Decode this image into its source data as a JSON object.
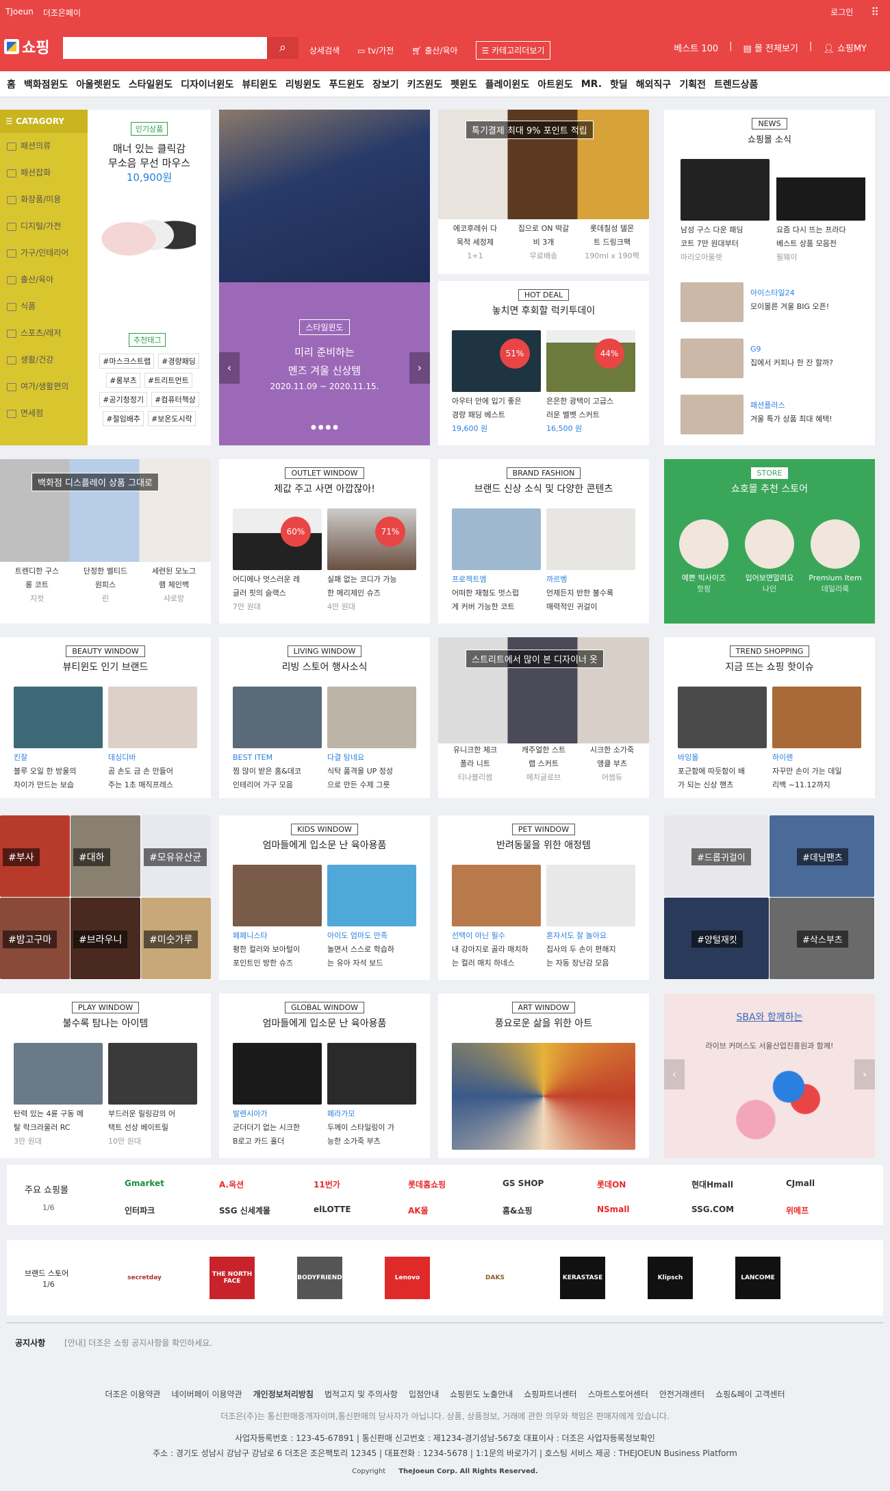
{
  "topbar": {
    "brand": "TJoeun",
    "pay": "더조은페이",
    "login": "로그인"
  },
  "header": {
    "logo": "쇼핑",
    "search_placeholder": "",
    "detail": "상세검색",
    "tv": "tv/가전",
    "baby": "출산/육아",
    "catall": "카테고리더보기",
    "best": "베스트 100",
    "seeall": "몰 전체보기",
    "my": "쇼핑MY"
  },
  "cats": [
    "홈",
    "백화점윈도",
    "아울렛윈도",
    "스타일윈도",
    "디자이너윈도",
    "뷰티윈도",
    "리빙윈도",
    "푸드윈도",
    "장보기",
    "키즈윈도",
    "펫윈도",
    "플레이윈도",
    "아트윈도",
    "MR.",
    "핫딜",
    "해외직구",
    "기획전",
    "트렌드상품"
  ],
  "sidebar": {
    "title": "CATAGORY",
    "items": [
      "패션의류",
      "패션잡화",
      "화장품/미용",
      "디지털/가전",
      "가구/인테리어",
      "출산/육아",
      "식품",
      "스포츠/레저",
      "생활/건강",
      "여가/생활편의",
      "면세점"
    ]
  },
  "popular": {
    "tag": "인기상품",
    "title1": "매너 있는 클릭감",
    "title2": "무소음 무선 마우스",
    "price": "10,900원",
    "rectag": "추천태그",
    "tags": [
      "#마스크스트랩",
      "#경량패딩",
      "#롱부츠",
      "#트리트먼트",
      "#공기청정기",
      "#컴퓨터책상",
      "#절임배추",
      "#보온도시락"
    ]
  },
  "hero": {
    "tag": "스타일윈도",
    "l1": "미리 준비하는",
    "l2": "멘즈 겨울 신상템",
    "date": "2020.11.09 ~ 2020.11.15."
  },
  "promo": {
    "banner": "톡기결제 최대 9% 포인트 적립",
    "items": [
      {
        "n1": "에코후레쉬 다",
        "n2": "목적 세정제",
        "s": "1+1"
      },
      {
        "n1": "집으로 ON 떡갈",
        "n2": "비 3개",
        "s": "무료배송"
      },
      {
        "n1": "롯데칠성 델몬",
        "n2": "트 드링크팩",
        "s": "190ml x 190팩"
      }
    ]
  },
  "news": {
    "tag": "NEWS",
    "title": "쇼핑몰 소식",
    "items": [
      {
        "n1": "남성 구스 다운 패딩",
        "n2": "코트 7만 원대부터",
        "s": "마리오아울렛"
      },
      {
        "n1": "요즘 다시 뜨는 프라다",
        "n2": "베스트 상품 모음전",
        "s": "필웨이"
      }
    ],
    "list": [
      {
        "b": "아이스타일24",
        "t": "모이몰른 겨울 BIG 오픈!"
      },
      {
        "b": "G9",
        "t": "집에서 커피나 한 잔 할까?"
      },
      {
        "b": "패션플러스",
        "t": "겨울 특가 상품 최대 혜택!"
      }
    ]
  },
  "hotdeal": {
    "tag": "HOT DEAL",
    "title": "놓치면 후회할 럭키투데이",
    "items": [
      {
        "pct": "51%",
        "n1": "아우터 안에 입기 좋은",
        "n2": "경량 패딩 베스트",
        "p": "19,600 원"
      },
      {
        "pct": "44%",
        "n1": "은은한 광택이 고급스",
        "n2": "러운 벨벳 스커트",
        "p": "16,500 원"
      }
    ]
  },
  "row2": {
    "dept": {
      "banner": "백화점 디스플레이 상품 그대로",
      "items": [
        {
          "n1": "트렌디한 구스",
          "n2": "롱 코트",
          "s": "지컷"
        },
        {
          "n1": "단정한 벨티드",
          "n2": "원피스",
          "s": "린"
        },
        {
          "n1": "세련된 모노그",
          "n2": "램 체인백",
          "s": "샤로랑"
        }
      ]
    },
    "outlet": {
      "tag": "OUTLET WINDOW",
      "title": "제값 주고 사면 아깝잖아!",
      "items": [
        {
          "pct": "60%",
          "n1": "어디에나 멋스러운 레",
          "n2": "글러 핏의 슬랙스",
          "s": "7만 원대"
        },
        {
          "pct": "71%",
          "n1": "실패 없는 코디가 가능",
          "n2": "한 메리제인 슈즈",
          "s": "4만 원대"
        }
      ]
    },
    "brand": {
      "tag": "BRAND FASHION",
      "title": "브랜드 신상 소식 및 다양한 콘텐츠",
      "items": [
        {
          "b": "프로젝트엠",
          "n1": "어떠한 재형도 멋스럽",
          "n2": "게 커버 가능한 코트"
        },
        {
          "b": "까르벵",
          "n1": "언제든지 반한 불수록",
          "n2": "매력적인 귀걸이"
        }
      ]
    },
    "store": {
      "tag": "STORE",
      "title": "쇼호몰 추천 스토어",
      "items": [
        {
          "n": "예쁜 빅사이즈",
          "s": "핫핑"
        },
        {
          "n": "입어보면알려요",
          "s": "나인"
        },
        {
          "n": "Premium Item",
          "s": "데일리룩"
        }
      ]
    }
  },
  "row3": {
    "beauty": {
      "tag": "BEAUTY WINDOW",
      "title": "뷰티윈도 인기 브랜드",
      "items": [
        {
          "b": "킨잘",
          "n1": "블루 오일 한 방울의",
          "n2": "차이가 만드는 보습"
        },
        {
          "b": "데싱디바",
          "n1": "곰 손도 금 손 만들어",
          "n2": "주는 1초 매직프레스"
        }
      ]
    },
    "living": {
      "tag": "LIVING WINDOW",
      "title": "리빙 스토어 행사소식",
      "items": [
        {
          "b": "BEST ITEM",
          "n1": "찜 많이 받은 홈&데코",
          "n2": "인테리어 가구 모음"
        },
        {
          "b": "다결 탕네요",
          "n1": "식탁 품격을 UP 정성",
          "n2": "으로 만든 수제 그릇"
        }
      ]
    },
    "street": {
      "banner": "스트리트에서 많이 본 디자이너 옷",
      "items": [
        {
          "n1": "유니크한 체크",
          "n2": "폴라 니트",
          "s": "티나블리썸"
        },
        {
          "n1": "캐주얼한 스트",
          "n2": "랩 스커트",
          "s": "메치글로브"
        },
        {
          "n1": "시크한 소가죽",
          "n2": "앵클 부츠",
          "s": "어썸듀"
        }
      ]
    },
    "trend": {
      "tag": "TREND SHOPPING",
      "title": "지금 뜨는 쇼핑 핫이슈",
      "items": [
        {
          "b": "바잉몰",
          "n1": "포근함에 따듯함이 배",
          "n2": "가 되는 신상 핸츠"
        },
        {
          "b": "하이렌",
          "n1": "자꾸만 손이 가는 데일",
          "n2": "리백 ~11.12까지"
        }
      ]
    }
  },
  "row4": {
    "food": {
      "labels": [
        "#부사",
        "#대하",
        "#모유유산균",
        "#밤고구마",
        "#브라우니",
        "#미숫가루"
      ]
    },
    "kids": {
      "tag": "KIDS WINDOW",
      "title": "엄마들에게 입소문 난 육아용품",
      "items": [
        {
          "b": "페페니스타",
          "n1": "평한 컬러와 보아털이",
          "n2": "포인트인 방한 슈즈"
        },
        {
          "b": "아이도 엄마도 만족",
          "n1": "놀면서 스스로 학습하",
          "n2": "는 유아 자석 보드"
        }
      ]
    },
    "pet": {
      "tag": "PET WINDOW",
      "title": "반려동물을 위한 애정템",
      "items": [
        {
          "b": "선택이 아닌 필수",
          "n1": "내 강아지로 골라 매치하",
          "n2": "는 컬러 매치 하네스"
        },
        {
          "b": "혼자서도 잘 놀아요",
          "n1": "집사의 두 손이 편해지",
          "n2": "는 자동 장난감 모음"
        }
      ]
    },
    "fashion": {
      "labels": [
        "#드롭귀걸이",
        "#데님팬츠",
        "#양털재킷",
        "#삭스부츠"
      ]
    }
  },
  "row5": {
    "play": {
      "tag": "PLAY WINDOW",
      "title": "불수록 탐나는 아이템",
      "items": [
        {
          "n1": "탄력 있는 4륜 구동 메",
          "n2": "탈 락크라울러 RC",
          "s": "3만 원대"
        },
        {
          "n1": "부드러운 릴링감의 어",
          "n2": "택트 선상 베이트릴",
          "s": "10만 원대"
        }
      ]
    },
    "global": {
      "tag": "GLOBAL WINDOW",
      "title": "엄마들에게 입소문 난 육아용품",
      "items": [
        {
          "b": "발렌시아가",
          "n1": "군더더기 없는 시크한",
          "n2": "B로고 카드 홀더"
        },
        {
          "b": "페라가모",
          "n1": "두께이 스타일링이 가",
          "n2": "능한 소가죽 부츠"
        }
      ]
    },
    "art": {
      "tag": "ART WINDOW",
      "title": "풍요로운 삶을 위한 아트"
    },
    "sba": {
      "title": "SBA와 함께하는",
      "sub": "라이브 커머스도 서울산업진흥원과 함께!"
    }
  },
  "malls": {
    "title": "주요 쇼핑몰",
    "page": "1/6",
    "names": [
      "Gmarket",
      "A.옥션",
      "11번가",
      "롯데홈쇼핑",
      "GS SHOP",
      "롯데ON",
      "현대Hmall",
      "CJmall",
      "인터파크",
      "SSG 신세계몰",
      "elLOTTE",
      "AK몰",
      "홈&쇼핑",
      "NSmall",
      "SSG.COM",
      "위메프"
    ]
  },
  "brands": {
    "title": "브랜드 스토어",
    "page": "1/6",
    "names": [
      "secretday",
      "THE NORTH FACE",
      "BODYFRIEND",
      "Lenovo",
      "DAKS",
      "KERASTASE",
      "Klipsch",
      "LANCOME"
    ]
  },
  "notice": {
    "title": "공지사항",
    "text": "[안내] 더조은 쇼핑 공지사항을 확인하세요."
  },
  "footer": {
    "links": [
      "더조은 이용약관",
      "네이버페이 이용약관",
      "개인정보처리방침",
      "법적고지 및 주의사항",
      "입점안내",
      "쇼핑윈도 노출안내",
      "쇼핑파트너센터",
      "스마트스토어센터",
      "안전거래센터",
      "쇼핑&페이 고객센터"
    ],
    "disc": "더조은(주)는 통신판매중개자이며,통신판매의 당사자가 아닙니다. 상품, 상품정보, 거래에 관한 의무와 책임은 판매자에게 있습니다.",
    "biz": "사업자등록번호 : 123-45-67891 | 통신판매 신고번호 : 제1234-경기성남-567호 대표이사 : 더조은 사업자등록정보확인",
    "addr": "주소 : 경기도 성남시 강남구 강남로 6 더조은 조은팩토리 12345 | 대표전화 : 1234-5678 | 1:1문의 바로가기 | 호스팅 서비스 제공 : THEJOEUN Business Platform",
    "copy1": "Copyright",
    "copy2": "TheJoeun Corp. All Rights Reserved."
  }
}
